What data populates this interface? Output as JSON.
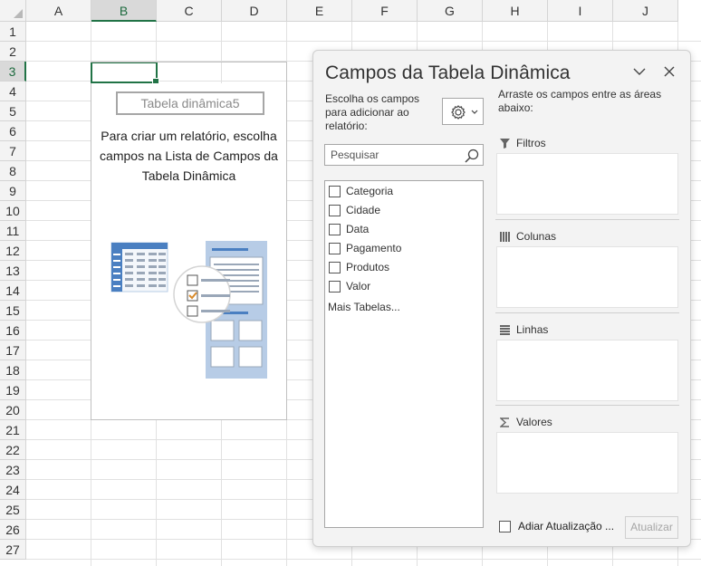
{
  "sheet": {
    "columns": [
      "A",
      "B",
      "C",
      "D",
      "E",
      "F",
      "G",
      "H",
      "I",
      "J"
    ],
    "rows": [
      "1",
      "2",
      "3",
      "4",
      "5",
      "6",
      "7",
      "8",
      "9",
      "10",
      "11",
      "12",
      "13",
      "14",
      "15",
      "16",
      "17",
      "18",
      "19",
      "20",
      "21",
      "22",
      "23",
      "24",
      "25",
      "26",
      "27"
    ],
    "selected_column": "B",
    "selected_row": "3"
  },
  "pivot_placeholder": {
    "name": "Tabela dinâmica5",
    "message": "Para criar um relatório, escolha campos na Lista de Campos da Tabela Dinâmica"
  },
  "field_pane": {
    "title": "Campos da Tabela Dinâmica",
    "choose_text": "Escolha os campos para adicionar ao relatório:",
    "drag_text": "Arraste os campos entre as áreas abaixo:",
    "search_placeholder": "Pesquisar",
    "fields": [
      {
        "label": "Categoria",
        "checked": false
      },
      {
        "label": "Cidade",
        "checked": false
      },
      {
        "label": "Data",
        "checked": false
      },
      {
        "label": "Pagamento",
        "checked": false
      },
      {
        "label": "Produtos",
        "checked": false
      },
      {
        "label": "Valor",
        "checked": false
      }
    ],
    "more_tables": "Mais Tabelas...",
    "areas": {
      "filters": "Filtros",
      "columns": "Colunas",
      "rows": "Linhas",
      "values": "Valores"
    },
    "defer_update": "Adiar Atualização ...",
    "update_button": "Atualizar"
  },
  "colors": {
    "excel_green": "#217346",
    "illustration_blue": "#4a7fc1",
    "illustration_light": "#b7cce6"
  }
}
